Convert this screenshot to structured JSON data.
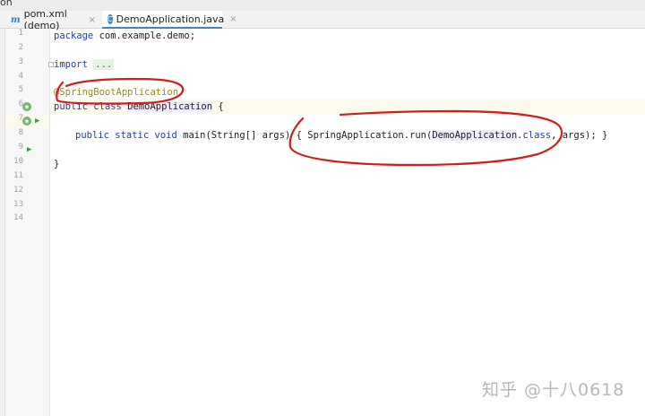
{
  "window": {
    "title_fragment": "on"
  },
  "tabs": [
    {
      "icon": "maven-icon",
      "glyph": "m",
      "label": "pom.xml (demo)",
      "close": "×",
      "active": false
    },
    {
      "icon": "java-class-icon",
      "glyph": "C",
      "label": "DemoApplication.java",
      "close": "×",
      "active": true
    }
  ],
  "gutter": {
    "line_numbers": [
      "1",
      "2",
      "3",
      "4",
      "5",
      "6",
      "7",
      "8",
      "9",
      "10",
      "11",
      "12",
      "13",
      "14"
    ]
  },
  "code": {
    "line1": {
      "kw": "package",
      "rest": " com.example.demo;"
    },
    "line3": {
      "kw": "import",
      "space": " ",
      "folded": "..."
    },
    "line6": {
      "annotation": "@SpringBootApplication"
    },
    "line7": {
      "kw1": "public",
      "kw2": "class",
      "cls": "DemoApplication",
      "brace": " {"
    },
    "line9": {
      "kw1": "public",
      "kw2": "static",
      "kw3": "void",
      "method": "main",
      "params": "(String[] args) { ",
      "call": "SpringApplication.run(",
      "cls": "DemoApplication",
      "dot_class": ".",
      "kw_class": "class",
      "tail": ", args); }"
    },
    "line12": {
      "brace": "}"
    }
  },
  "annotations": {
    "ink_color": "#d11c1c"
  },
  "watermark": {
    "text": "知乎 @十八0618"
  }
}
